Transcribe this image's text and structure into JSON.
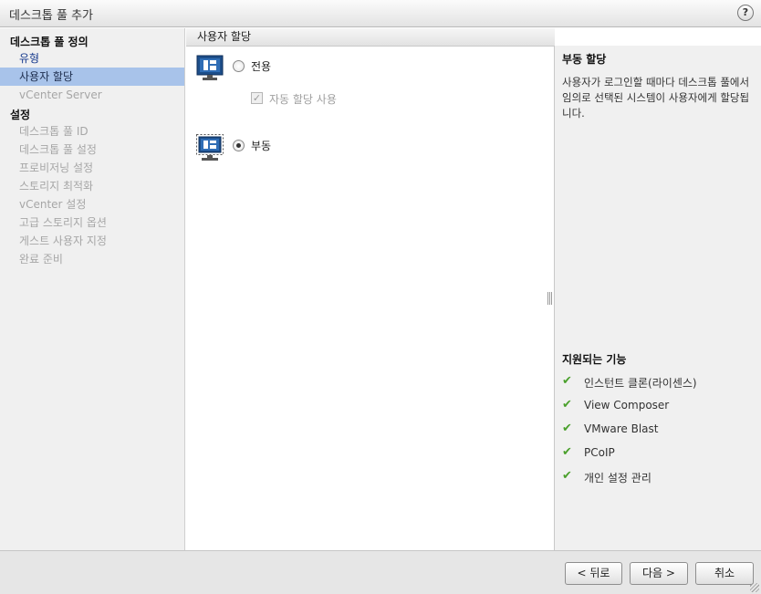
{
  "dialog": {
    "title": "데스크톱 풀 추가",
    "help_label": "?"
  },
  "sidebar": {
    "group1_heading": "데스크톱 풀 정의",
    "group1_items": [
      {
        "label": "유형",
        "state": "done"
      },
      {
        "label": "사용자 할당",
        "state": "active"
      },
      {
        "label": "vCenter Server",
        "state": "disabled"
      }
    ],
    "group2_heading": "설정",
    "group2_items": [
      {
        "label": "데스크톱 풀 ID"
      },
      {
        "label": "데스크톱 풀 설정"
      },
      {
        "label": "프로비저닝 설정"
      },
      {
        "label": "스토리지 최적화"
      },
      {
        "label": "vCenter 설정"
      },
      {
        "label": "고급 스토리지 옵션"
      },
      {
        "label": "게스트 사용자 지정"
      },
      {
        "label": "완료 준비"
      }
    ]
  },
  "main": {
    "section_title": "사용자 할당",
    "options": [
      {
        "label": "전용",
        "selected": false,
        "icon": "dedicated-pool-icon"
      },
      {
        "label": "부동",
        "selected": true,
        "icon": "floating-pool-icon"
      }
    ],
    "auto_assign": {
      "label": "자동 할당 사용",
      "checked": true,
      "enabled": false
    }
  },
  "help": {
    "title": "부동 할당",
    "text": "사용자가 로그인할 때마다 데스크톱 풀에서 임의로 선택된 시스템이 사용자에게 할당됩니다.",
    "features_title": "지원되는 기능",
    "features": [
      "인스턴트 클론(라이센스)",
      "View Composer",
      "VMware Blast",
      "PCoIP",
      "개인 설정 관리"
    ]
  },
  "footer": {
    "back_label": "< 뒤로",
    "next_label": "다음 >",
    "cancel_label": "취소"
  },
  "colors": {
    "active_nav": "#a8c3ea",
    "done_nav": "#1a3d8f",
    "check": "#4aa02c",
    "icon_blue": "#1d4e89"
  }
}
